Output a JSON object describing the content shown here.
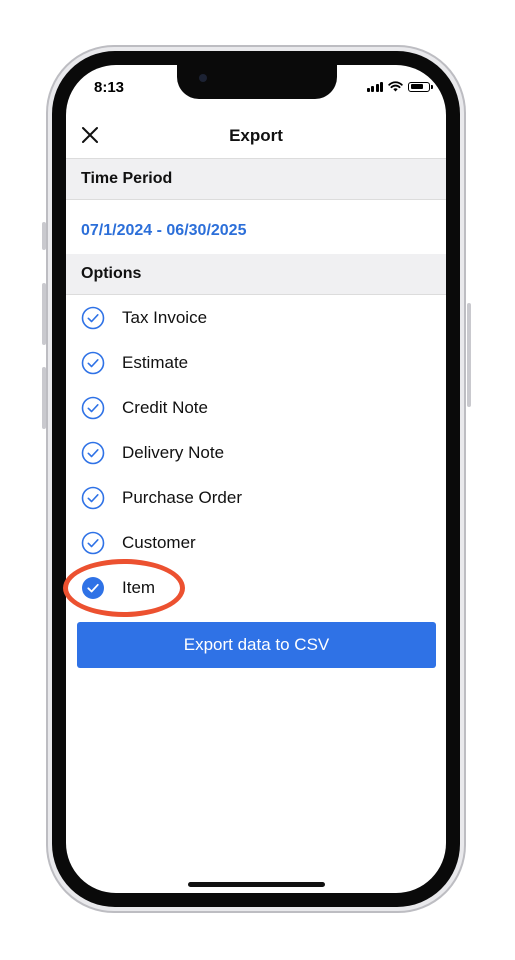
{
  "status_bar": {
    "time": "8:13",
    "icons": [
      "cellular-signal-icon",
      "wifi-icon",
      "battery-icon"
    ]
  },
  "nav": {
    "title": "Export",
    "close_icon": "close-icon"
  },
  "time_period": {
    "header": "Time Period",
    "value": "07/1/2024 - 06/30/2025"
  },
  "options": {
    "header": "Options",
    "items": [
      {
        "label": "Tax Invoice",
        "checked": false
      },
      {
        "label": "Estimate",
        "checked": false
      },
      {
        "label": "Credit Note",
        "checked": false
      },
      {
        "label": "Delivery Note",
        "checked": false
      },
      {
        "label": "Purchase Order",
        "checked": false
      },
      {
        "label": "Customer",
        "checked": false
      },
      {
        "label": "Item",
        "checked": true
      }
    ]
  },
  "export_button": {
    "label": "Export data to CSV"
  },
  "colors": {
    "accent": "#2f72e6",
    "period_text": "#2c6fd9",
    "section_bg": "#f0f0f2",
    "highlight": "#ec5130"
  }
}
